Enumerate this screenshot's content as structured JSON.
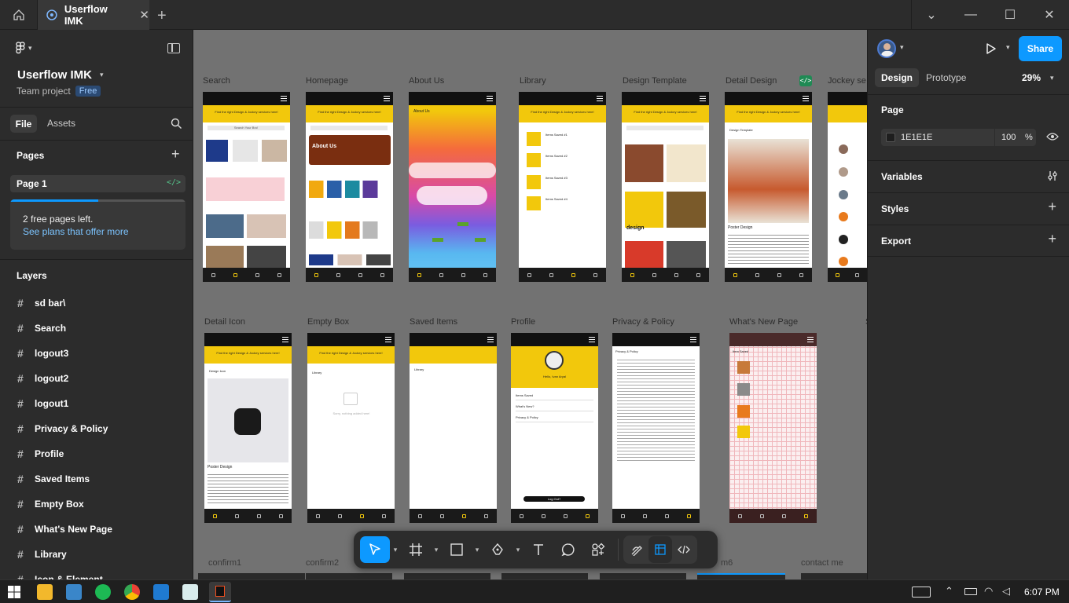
{
  "titlebar": {
    "tab_title": "Userflow IMK"
  },
  "left": {
    "file_name": "Userflow IMK",
    "project": "Team project",
    "plan_badge": "Free",
    "tabs": [
      "File",
      "Assets"
    ],
    "pages_heading": "Pages",
    "current_page": "Page 1",
    "pages_notice": "2 free pages left.",
    "pages_link": "See plans that offer more",
    "pages_progress": 0.5,
    "layers_heading": "Layers",
    "layers": [
      "sd bar\\",
      "Search",
      "logout3",
      "logout2",
      "logout1",
      "Privacy & Policy",
      "Profile",
      "Saved Items",
      "Empty Box",
      "What's New Page",
      "Library",
      "Icon & Element"
    ]
  },
  "canvas": {
    "row1": [
      "Search",
      "Homepage",
      "About Us",
      "Library",
      "Design Template",
      "Detail Design",
      "Jockey se"
    ],
    "row2": [
      "Detail Icon",
      "Empty Box",
      "Saved Items",
      "Profile",
      "Privacy & Policy",
      "What's New Page",
      "S"
    ],
    "row3": [
      "confirm1",
      "confirm2",
      "m6",
      "contact me"
    ],
    "hero_text": "Find the right Design & Jockey services here!",
    "search_placeholder": "Search Your Bro!",
    "library_items": [
      "Items Saved #1",
      "Items Saved #2",
      "Items Saved #3",
      "Items Saved #4"
    ],
    "profile_name": "Hello, Ivan Aryal",
    "profile_menu": [
      "Items Saved",
      "What's New?",
      "Privacy & Policy"
    ],
    "logout_label": "Log Out?",
    "empty_text": "Sorry, nothing added here!",
    "back_library": "Library",
    "back_design_template": "Design Template",
    "back_design_icon": "Design Icon",
    "back_privacy": "Privacy & Policy",
    "back_item_saved": "Item Saved",
    "about_title": "About Us",
    "poster_design": "Poster Design",
    "design_word": "design"
  },
  "right": {
    "tabs": [
      "Design",
      "Prototype"
    ],
    "zoom": "29%",
    "share_label": "Share",
    "page_heading": "Page",
    "bg_hex": "1E1E1E",
    "bg_opacity": "100",
    "pct": "%",
    "sections": [
      "Variables",
      "Styles",
      "Export"
    ]
  },
  "taskbar": {
    "time": "6:07 PM"
  },
  "colors": {
    "accent": "#0d99ff",
    "yellow": "#f2c80c",
    "canvas": "#727272"
  }
}
